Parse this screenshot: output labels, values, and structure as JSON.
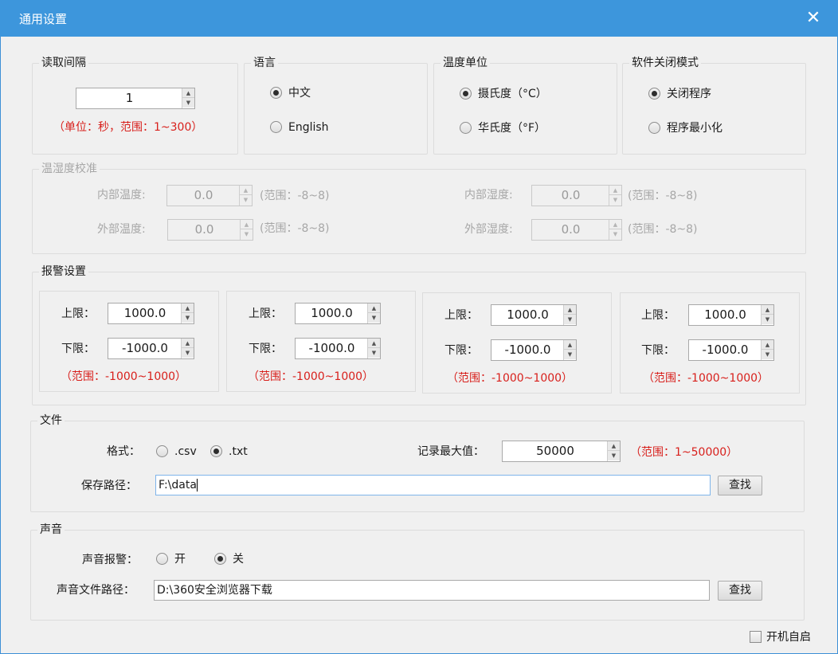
{
  "window": {
    "title": "通用设置",
    "close_icon": "close-icon"
  },
  "read_interval": {
    "legend": "读取间隔",
    "value": "1",
    "hint": "（单位：秒，范围：1~300）"
  },
  "language": {
    "legend": "语言",
    "options": [
      {
        "label": "中文",
        "selected": true
      },
      {
        "label": "English",
        "selected": false
      }
    ]
  },
  "temp_unit": {
    "legend": "温度单位",
    "options": [
      {
        "label": "摄氏度（°C）",
        "selected": true
      },
      {
        "label": "华氏度（°F）",
        "selected": false
      }
    ]
  },
  "close_mode": {
    "legend": "软件关闭模式",
    "options": [
      {
        "label": "关闭程序",
        "selected": true
      },
      {
        "label": "程序最小化",
        "selected": false
      }
    ]
  },
  "calibration": {
    "legend": "温湿度校准",
    "inner_temp_label": "内部温度:",
    "inner_temp_value": "0.0",
    "outer_temp_label": "外部温度:",
    "outer_temp_value": "0.0",
    "inner_humid_label": "内部湿度:",
    "inner_humid_value": "0.0",
    "outer_humid_label": "外部湿度:",
    "outer_humid_value": "0.0",
    "range_hint": "(范围：-8~8)"
  },
  "alarm": {
    "legend": "报警设置",
    "upper_label": "上限：",
    "lower_label": "下限：",
    "range_hint": "（范围：-1000~1000）",
    "channels": [
      {
        "upper": "1000.0",
        "lower": "-1000.0"
      },
      {
        "upper": "1000.0",
        "lower": "-1000.0"
      },
      {
        "upper": "1000.0",
        "lower": "-1000.0"
      },
      {
        "upper": "1000.0",
        "lower": "-1000.0"
      }
    ]
  },
  "file": {
    "legend": "文件",
    "format_label": "格式：",
    "format_options": [
      {
        "label": ".csv",
        "selected": false
      },
      {
        "label": ".txt",
        "selected": true
      }
    ],
    "max_label": "记录最大值：",
    "max_value": "50000",
    "max_hint": "（范围：1~50000）",
    "path_label": "保存路径：",
    "path_value": "F:\\data",
    "browse_label": "查找"
  },
  "sound": {
    "legend": "声音",
    "alarm_label": "声音报警：",
    "options": [
      {
        "label": "开",
        "selected": false
      },
      {
        "label": "关",
        "selected": true
      }
    ],
    "path_label": "声音文件路径：",
    "path_value": "D:\\360安全浏览器下载",
    "browse_label": "查找"
  },
  "autostart": {
    "label": "开机自启",
    "checked": false
  }
}
